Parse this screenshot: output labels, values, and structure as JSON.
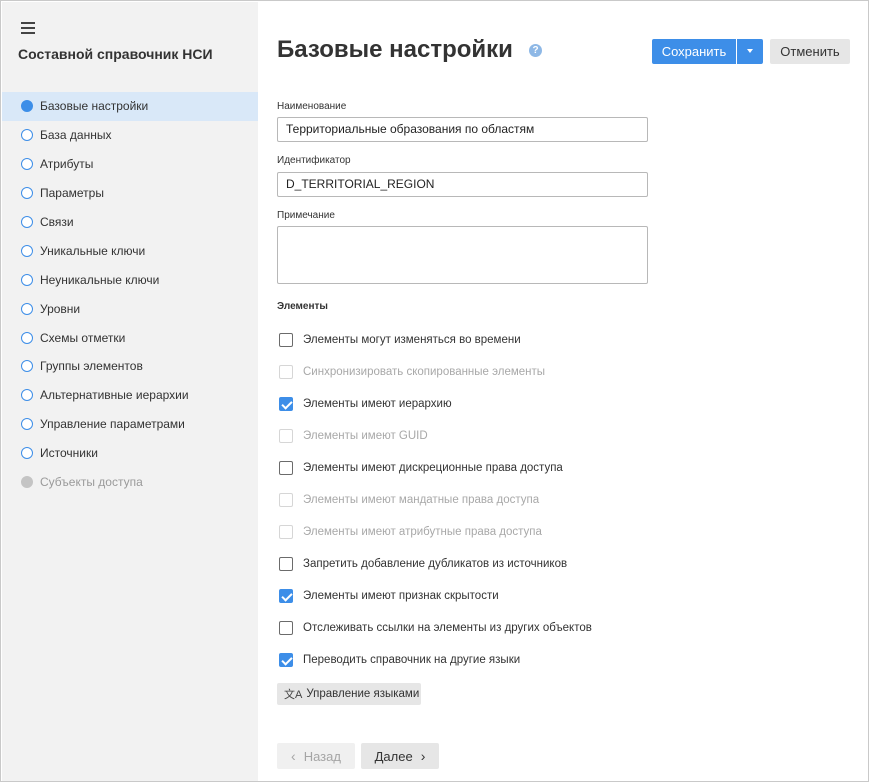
{
  "sidebar": {
    "title": "Составной справочник НСИ",
    "items": [
      {
        "label": "Базовые настройки"
      },
      {
        "label": "База данных"
      },
      {
        "label": "Атрибуты"
      },
      {
        "label": "Параметры"
      },
      {
        "label": "Связи"
      },
      {
        "label": "Уникальные ключи"
      },
      {
        "label": "Неуникальные ключи"
      },
      {
        "label": "Уровни"
      },
      {
        "label": "Схемы отметки"
      },
      {
        "label": "Группы элементов"
      },
      {
        "label": "Альтернативные иерархии"
      },
      {
        "label": "Управление параметрами"
      },
      {
        "label": "Источники"
      },
      {
        "label": "Субъекты доступа"
      }
    ]
  },
  "header": {
    "title": "Базовые настройки",
    "help_icon": "?",
    "save_label": "Сохранить",
    "cancel_label": "Отменить"
  },
  "form": {
    "name_label": "Наименование",
    "name_value": "Территориальные образования по областям",
    "id_label": "Идентификатор",
    "id_value": "D_TERRITORIAL_REGION",
    "note_label": "Примечание",
    "note_value": ""
  },
  "elements": {
    "title": "Элементы",
    "options": [
      {
        "label": "Элементы могут изменяться во времени"
      },
      {
        "label": "Синхронизировать скопированные элементы"
      },
      {
        "label": "Элементы имеют иерархию"
      },
      {
        "label": "Элементы имеют GUID"
      },
      {
        "label": "Элементы имеют дискреционные права доступа"
      },
      {
        "label": "Элементы имеют мандатные права доступа"
      },
      {
        "label": "Элементы имеют атрибутные права доступа"
      },
      {
        "label": "Запретить добавление дубликатов из источников"
      },
      {
        "label": "Элементы имеют признак скрытости"
      },
      {
        "label": "Отслеживать ссылки на элементы из других объектов"
      },
      {
        "label": "Переводить справочник на другие языки"
      }
    ],
    "languages_button": "Управление языками"
  },
  "footer": {
    "back_label": "Назад",
    "next_label": "Далее"
  },
  "colors": {
    "accent": "#3d8ee8",
    "sidebar_bg": "#f2f2f2",
    "active_item_bg": "#d9e8f8"
  }
}
